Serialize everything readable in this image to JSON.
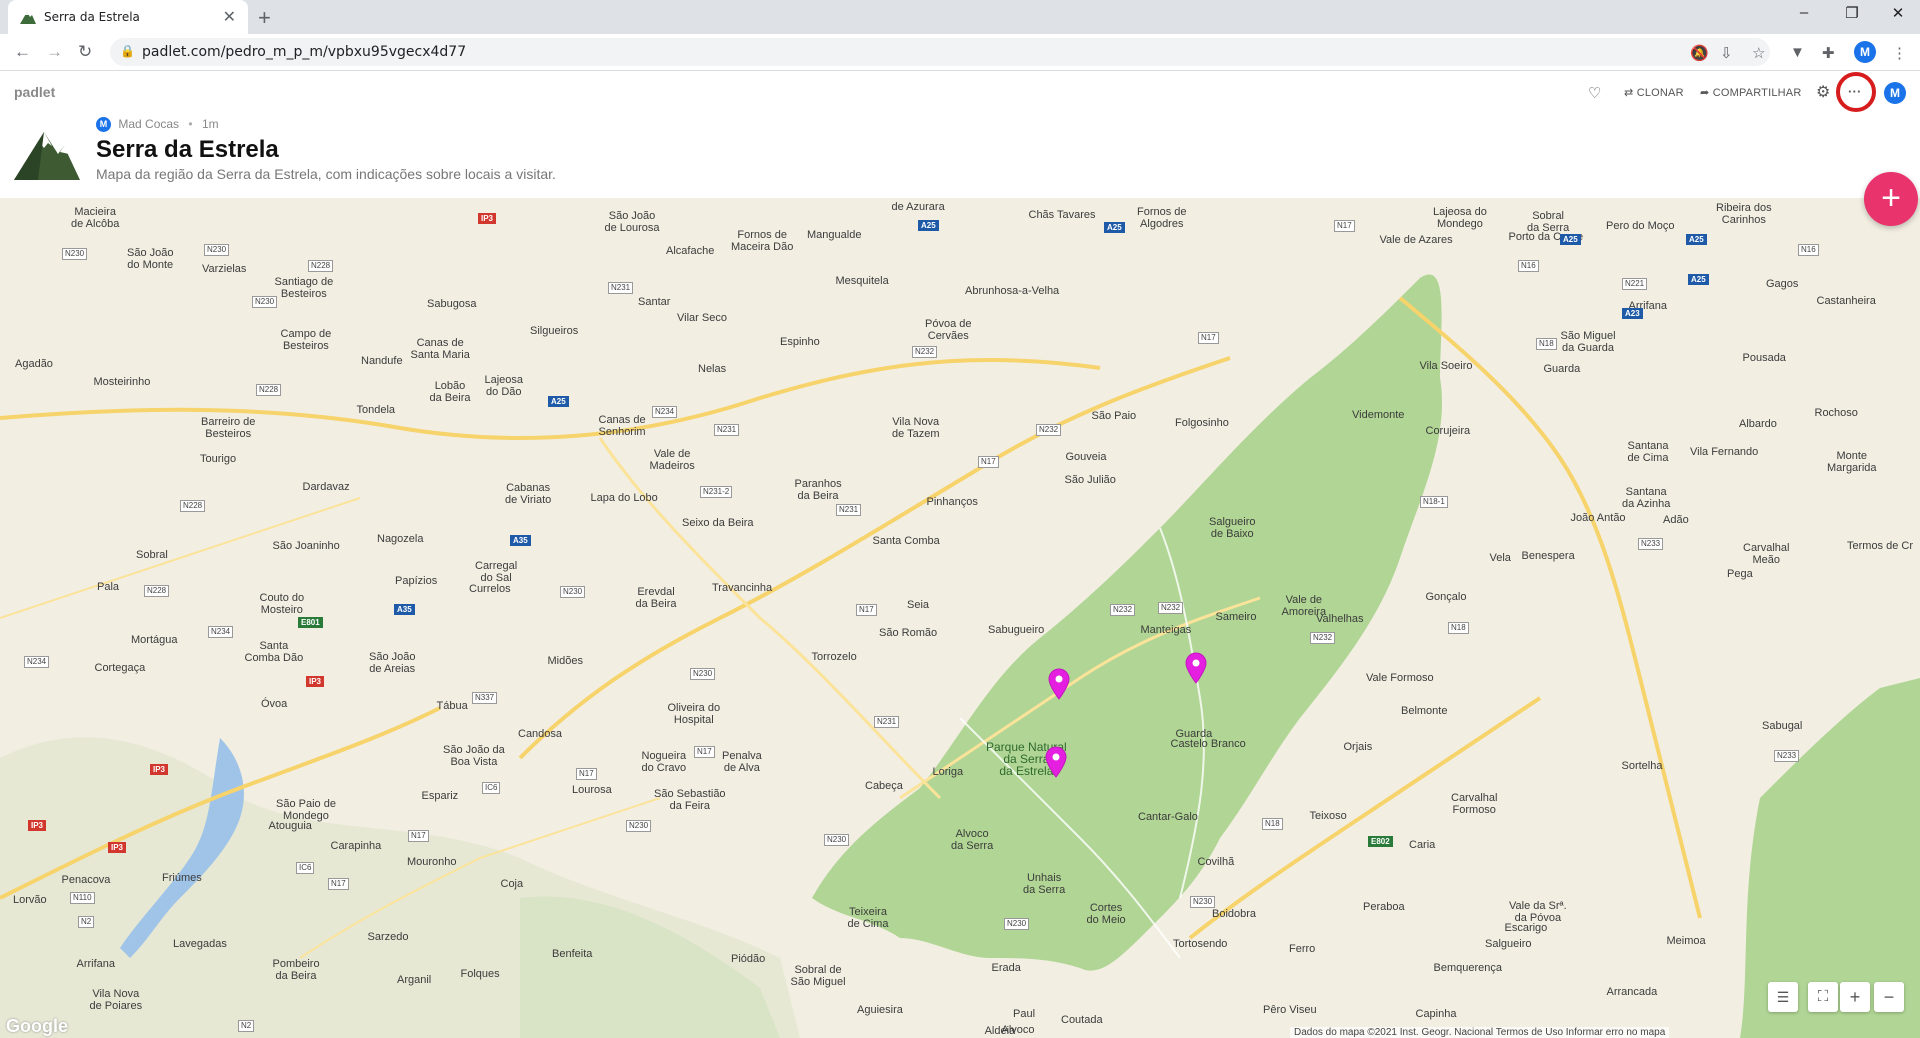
{
  "browser": {
    "tab_title": "Serra da Estrela",
    "tab_close": "✕",
    "new_tab": "+",
    "url": "padlet.com/pedro_m_p_m/vpbxu95vgecx4d77",
    "profile_initial": "M",
    "window_controls": [
      "–",
      "❐",
      "✕"
    ]
  },
  "padlet": {
    "logo": "padlet",
    "author": "Mad Cocas",
    "author_initial": "M",
    "time_ago": "1m",
    "title": "Serra da Estrela",
    "description": "Mapa da região da Serra da Estrela, com indicações sobre locais a visitar.",
    "actions": {
      "clone": "CLONAR",
      "share": "COMPARTILHAR",
      "more": "···"
    },
    "user_initial": "M",
    "fab": "+"
  },
  "map": {
    "park_label": "Parque Natural\nda Serra\nda Estrela",
    "attribution": "Dados do mapa ©2021 Inst. Geogr. Nacional   Termos de Uso   Informar erro no mapa",
    "google": "Google",
    "places": [
      [
        "Macieira\nde Alcôba",
        95,
        212
      ],
      [
        "São João\ndo Monte",
        150,
        253
      ],
      [
        "Varzielas",
        224,
        269
      ],
      [
        "Santiago de\nBesteiros",
        304,
        282
      ],
      [
        "Sabugosa",
        452,
        304
      ],
      [
        "Silgueiros",
        554,
        331
      ],
      [
        "Campo de\nBesteiros",
        306,
        334
      ],
      [
        "Canas de\nSanta Maria",
        440,
        343
      ],
      [
        "Nandufe",
        382,
        361
      ],
      [
        "Lobão\nda Beira",
        450,
        386
      ],
      [
        "Lajeosa\ndo Dão",
        504,
        380
      ],
      [
        "Agadão",
        34,
        364
      ],
      [
        "Mosteirinho",
        122,
        382
      ],
      [
        "Tondela",
        376,
        410
      ],
      [
        "Barreiro de\nBesteiros",
        228,
        422
      ],
      [
        "Tourigo",
        218,
        459
      ],
      [
        "Dardavaz",
        326,
        487
      ],
      [
        "Cabanas\nde Viriato",
        528,
        488
      ],
      [
        "Lapa do Lobo",
        624,
        498
      ],
      [
        "São Joaninho",
        306,
        546
      ],
      [
        "Nagozela",
        400,
        539
      ],
      [
        "Sobral",
        152,
        555
      ],
      [
        "Carregal\ndo Sal",
        496,
        566
      ],
      [
        "Papízios",
        416,
        581
      ],
      [
        "Currelos",
        490,
        589
      ],
      [
        "Pala",
        108,
        587
      ],
      [
        "Couto do\nMosteiro",
        282,
        598
      ],
      [
        "Mortágua",
        154,
        640
      ],
      [
        "Santa\nComba Dão",
        274,
        646
      ],
      [
        "São João\nde Areias",
        392,
        657
      ],
      [
        "Midões",
        565,
        661
      ],
      [
        "Cortegaça",
        120,
        668
      ],
      [
        "Óvoa",
        274,
        704
      ],
      [
        "Tábua",
        452,
        706
      ],
      [
        "Oliveira do\nHospital",
        694,
        708
      ],
      [
        "Candosa",
        540,
        734
      ],
      [
        "Nogueira\ndo Cravo",
        664,
        756
      ],
      [
        "São João da\nBoa Vista",
        474,
        750
      ],
      [
        "São Sebastião\nda Feira",
        690,
        794
      ],
      [
        "Lourosa",
        592,
        790
      ],
      [
        "Espariz",
        440,
        796
      ],
      [
        "São Paio de\nMondego",
        306,
        804
      ],
      [
        "Atouguia",
        290,
        826
      ],
      [
        "Carapinha",
        356,
        846
      ],
      [
        "Mouronho",
        432,
        862
      ],
      [
        "Coja",
        512,
        884
      ],
      [
        "Friúmes",
        182,
        878
      ],
      [
        "Penacova",
        86,
        880
      ],
      [
        "Lorvão",
        30,
        900
      ],
      [
        "Lavegadas",
        200,
        944
      ],
      [
        "Sarzedo",
        388,
        937
      ],
      [
        "Benfeita",
        572,
        954
      ],
      [
        "Arganil",
        414,
        980
      ],
      [
        "Pombeiro\nda Beira",
        296,
        964
      ],
      [
        "Folques",
        480,
        974
      ],
      [
        "Arrifana",
        96,
        964
      ],
      [
        "Vila Nova\nde Poiares",
        116,
        994
      ],
      [
        "Piódão",
        748,
        959
      ],
      [
        "Sobral de\nSão Miguel",
        818,
        970
      ],
      [
        "Teixeira\nde Cima",
        868,
        912
      ],
      [
        "Unhais\nda Serra",
        1044,
        878
      ],
      [
        "Cortes\ndo Meio",
        1106,
        908
      ],
      [
        "Alvoco\nda Serra",
        972,
        834
      ],
      [
        "Loriga",
        948,
        772
      ],
      [
        "Cabeça",
        884,
        786
      ],
      [
        "Torrozelo",
        834,
        657
      ],
      [
        "Seia",
        918,
        605
      ],
      [
        "São Romão",
        908,
        633
      ],
      [
        "Penalva\nde Alva",
        742,
        756
      ],
      [
        "Sabugueiro",
        1016,
        630
      ],
      [
        "Manteigas",
        1166,
        630
      ],
      [
        "Sameiro",
        1236,
        617
      ],
      [
        "Vale de\nAmoreira",
        1304,
        600
      ],
      [
        "Valhelhas",
        1340,
        619
      ],
      [
        "Folgosinho",
        1202,
        423
      ],
      [
        "Gouveia",
        1086,
        457
      ],
      [
        "São Julião",
        1090,
        480
      ],
      [
        "São Paio",
        1114,
        416
      ],
      [
        "Salgueiro\nde Baixo",
        1232,
        522
      ],
      [
        "Vila Nova\nde Tazem",
        916,
        422
      ],
      [
        "Pinhanços",
        952,
        502
      ],
      [
        "Santa Comba",
        906,
        541
      ],
      [
        "Paranhos\nda Beira",
        818,
        484
      ],
      [
        "Vale de\nMadeiros",
        672,
        454
      ],
      [
        "Canas de\nSenhorim",
        622,
        420
      ],
      [
        "Nelas",
        712,
        369
      ],
      [
        "Seixo da Beira",
        718,
        523
      ],
      [
        "Erevdal\nda Beira",
        656,
        592
      ],
      [
        "Travancinha",
        742,
        588
      ],
      [
        "Santar",
        654,
        302
      ],
      [
        "Vilar Seco",
        702,
        318
      ],
      [
        "Espinho",
        800,
        342
      ],
      [
        "Mesquitela",
        862,
        281
      ],
      [
        "Mangualde",
        834,
        235
      ],
      [
        "Fornos de\nMaceira Dão",
        762,
        235
      ],
      [
        "Alcafache",
        690,
        251
      ],
      [
        "São João\nde Lourosa",
        632,
        216
      ],
      [
        "Abrunhosa-a-Velha",
        1012,
        291
      ],
      [
        "Póvoa de\nCervães",
        948,
        324
      ],
      [
        "Chãs Tavares",
        1062,
        215
      ],
      [
        "Fornos de\nAlgodres",
        1162,
        212
      ],
      [
        "de Azurara",
        918,
        207
      ],
      [
        "Lajeosa do\nMondego",
        1460,
        212
      ],
      [
        "Vale de Azares",
        1416,
        240
      ],
      [
        "Sobral\nda Serra",
        1548,
        216
      ],
      [
        "Porto da Carne",
        1546,
        237
      ],
      [
        "Pero do Moço",
        1640,
        226
      ],
      [
        "Ribeira dos\nCarinhos",
        1744,
        208
      ],
      [
        "Gagos",
        1782,
        284
      ],
      [
        "Castanheira",
        1846,
        301
      ],
      [
        "Arrifana",
        1648,
        306
      ],
      [
        "São Miguel\nda Guarda",
        1588,
        336
      ],
      [
        "Pousada",
        1764,
        358
      ],
      [
        "Guarda",
        1562,
        369
      ],
      [
        "Vila Soeiro",
        1446,
        366
      ],
      [
        "Videmonte",
        1378,
        415
      ],
      [
        "Corujeira",
        1448,
        431
      ],
      [
        "Rochoso",
        1836,
        413
      ],
      [
        "Albardo",
        1758,
        424
      ],
      [
        "Vila Fernando",
        1724,
        452
      ],
      [
        "Monte\nMargarida",
        1852,
        456
      ],
      [
        "Santana\nde Cima",
        1648,
        446
      ],
      [
        "Santana\nda Azinha",
        1646,
        492
      ],
      [
        "João Antão",
        1598,
        518
      ],
      [
        "Adão",
        1676,
        520
      ],
      [
        "Carvalhal\nMeão",
        1766,
        548
      ],
      [
        "Termos de Cr",
        1880,
        546
      ],
      [
        "Vela",
        1500,
        558
      ],
      [
        "Benespera",
        1548,
        556
      ],
      [
        "Pega",
        1740,
        574
      ],
      [
        "Gonçalo",
        1446,
        597
      ],
      [
        "Vale Formoso",
        1400,
        678
      ],
      [
        "Belmonte",
        1424,
        711
      ],
      [
        "Orjais",
        1358,
        747
      ],
      [
        "Sabugal",
        1782,
        726
      ],
      [
        "Sortelha",
        1642,
        766
      ],
      [
        "Carvalhal\nFormoso",
        1474,
        798
      ],
      [
        "Teixoso",
        1328,
        816
      ],
      [
        "Caria",
        1422,
        845
      ],
      [
        "Covilhã",
        1216,
        862
      ],
      [
        "Cantar-Galo",
        1168,
        817
      ],
      [
        "Boidobra",
        1234,
        914
      ],
      [
        "Tortosendo",
        1200,
        944
      ],
      [
        "Peraboa",
        1384,
        907
      ],
      [
        "Vale da Srª.\nda Póvoa",
        1538,
        906
      ],
      [
        "Escarigo",
        1526,
        928
      ],
      [
        "Salgueiro",
        1508,
        944
      ],
      [
        "Bemquerença",
        1468,
        968
      ],
      [
        "Meimoa",
        1686,
        941
      ],
      [
        "Ferro",
        1302,
        949
      ],
      [
        "Erada",
        1006,
        968
      ],
      [
        "Paul",
        1024,
        1014
      ],
      [
        "Coutada",
        1082,
        1020
      ],
      [
        "Pêro Viseu",
        1290,
        1010
      ],
      [
        "Capinha",
        1436,
        1014
      ],
      [
        "Aldeia\nde Joanes",
        1000,
        1031
      ],
      [
        "Arrancada",
        1632,
        992
      ],
      [
        "Aguiesira",
        880,
        1010
      ],
      [
        "Alvoco",
        1018,
        1030
      ],
      [
        "Guarda",
        1194,
        734
      ],
      [
        "Castelo Branco",
        1208,
        744
      ]
    ]
  }
}
